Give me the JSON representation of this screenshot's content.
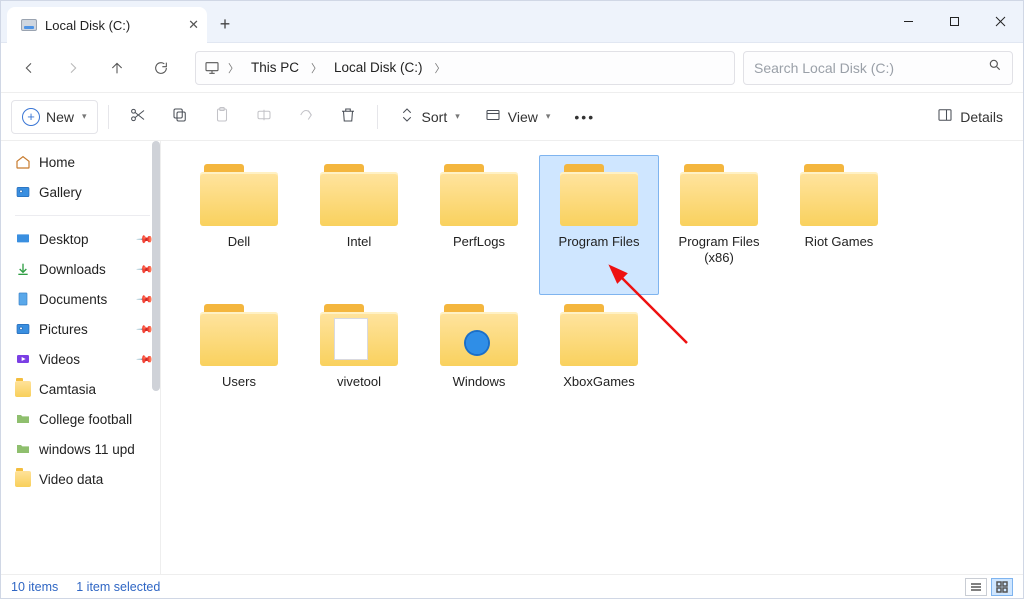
{
  "title": "Local Disk (C:)",
  "breadcrumbs": {
    "root_icon": "monitor",
    "segments": [
      "This PC",
      "Local Disk (C:)"
    ]
  },
  "search": {
    "placeholder": "Search Local Disk (C:)"
  },
  "toolbar": {
    "new": "New",
    "sort": "Sort",
    "view": "View",
    "details": "Details"
  },
  "sidebar": {
    "top": [
      {
        "icon": "home",
        "label": "Home"
      },
      {
        "icon": "gallery",
        "label": "Gallery"
      }
    ],
    "quick": [
      {
        "icon": "desktop",
        "label": "Desktop",
        "pinned": true
      },
      {
        "icon": "download",
        "label": "Downloads",
        "pinned": true
      },
      {
        "icon": "doc",
        "label": "Documents",
        "pinned": true
      },
      {
        "icon": "pic",
        "label": "Pictures",
        "pinned": true
      },
      {
        "icon": "vid",
        "label": "Videos",
        "pinned": true
      },
      {
        "icon": "folder",
        "label": "Camtasia",
        "pinned": false
      },
      {
        "icon": "folder-g",
        "label": "College football",
        "pinned": false
      },
      {
        "icon": "folder-g",
        "label": "windows 11 upd",
        "pinned": false
      },
      {
        "icon": "folder",
        "label": "Video data",
        "pinned": false
      }
    ]
  },
  "folders": [
    {
      "name": "Dell",
      "type": "folder"
    },
    {
      "name": "Intel",
      "type": "folder"
    },
    {
      "name": "PerfLogs",
      "type": "folder"
    },
    {
      "name": "Program Files",
      "type": "folder",
      "selected": true
    },
    {
      "name": "Program Files (x86)",
      "type": "folder"
    },
    {
      "name": "Riot Games",
      "type": "folder"
    },
    {
      "name": "Users",
      "type": "folder"
    },
    {
      "name": "vivetool",
      "type": "folder-doc"
    },
    {
      "name": "Windows",
      "type": "folder-win"
    },
    {
      "name": "XboxGames",
      "type": "folder"
    }
  ],
  "status": {
    "count": "10 items",
    "selection": "1 item selected"
  }
}
